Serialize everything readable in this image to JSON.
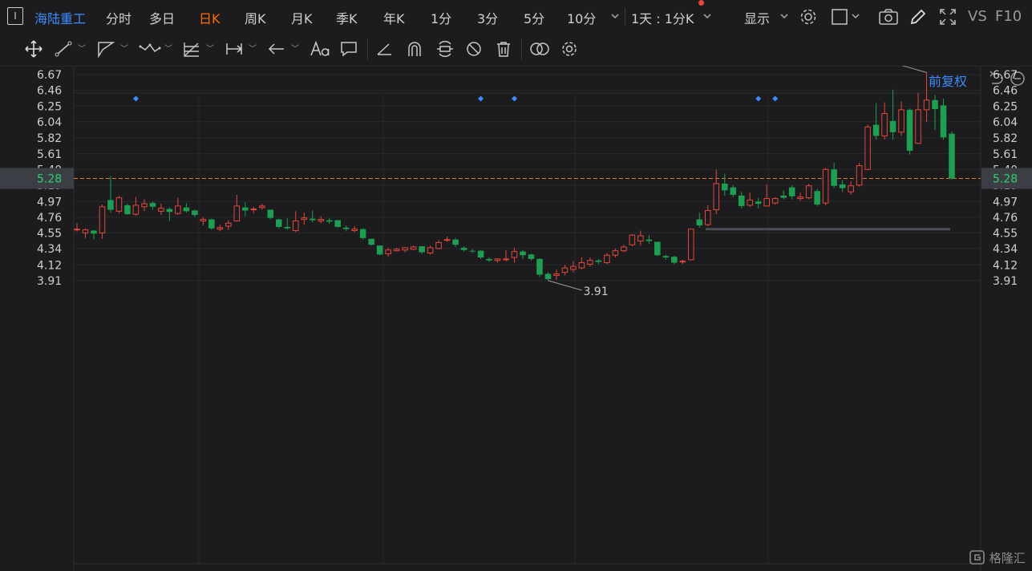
{
  "header": {
    "symbol_box": "I",
    "symbol_name": "海陆重工",
    "periods": [
      "分时",
      "多日",
      "日K",
      "周K",
      "月K",
      "季K",
      "年K",
      "1分",
      "3分",
      "5分",
      "10分"
    ],
    "active_period": "日K",
    "more_periods_icon": "chevron-down-icon",
    "interval_label": "1天 : 1分K",
    "display_label": "显示",
    "vs_label": "VS",
    "f10_label": "F10"
  },
  "tools": [
    "move-icon",
    "line-tool-icon",
    "polygon-tool-icon",
    "wave-tool-icon",
    "fib-tool-icon",
    "range-tool-icon",
    "arrow-tool-icon",
    "text-tool-icon",
    "comment-tool-icon",
    "angle-tool-icon",
    "magnet-icon",
    "sync-icon",
    "hide-drawings-icon",
    "trash-icon",
    "overlay-icon",
    "settings-icon"
  ],
  "adjust_label": "前复权",
  "watermark": "格隆汇",
  "colors": {
    "up": "#e5473b",
    "down": "#1e9e52",
    "accent": "#3d8bff",
    "active": "#ff6a00",
    "ref_line": "#e07a27"
  },
  "chart_data": {
    "type": "candlestick",
    "y_ticks": [
      6.67,
      6.46,
      6.25,
      6.04,
      5.82,
      5.61,
      5.4,
      5.19,
      4.97,
      4.76,
      4.55,
      4.34,
      4.12,
      3.91
    ],
    "ylim": [
      3.8,
      6.85
    ],
    "current_price": 5.28,
    "max_label": "6.70",
    "min_label": "3.91",
    "support_level": 4.6,
    "event_markers": [
      7,
      48,
      52,
      81,
      83,
      124,
      155,
      157,
      161,
      163,
      171,
      173,
      177,
      181
    ],
    "ohlc": [
      [
        4.59,
        4.6,
        4.57,
        4.68
      ],
      [
        4.55,
        4.59,
        4.48,
        4.61
      ],
      [
        4.58,
        4.54,
        4.46,
        4.59
      ],
      [
        4.55,
        4.9,
        4.47,
        4.93
      ],
      [
        4.99,
        4.86,
        4.82,
        5.31
      ],
      [
        4.84,
        5.02,
        4.81,
        5.05
      ],
      [
        4.92,
        4.8,
        4.79,
        4.94
      ],
      [
        4.8,
        4.92,
        4.78,
        5.03
      ],
      [
        4.9,
        4.94,
        4.84,
        5.0
      ],
      [
        4.95,
        4.9,
        4.86,
        4.97
      ],
      [
        4.84,
        4.88,
        4.79,
        4.94
      ],
      [
        4.87,
        4.83,
        4.71,
        4.89
      ],
      [
        4.81,
        4.91,
        4.79,
        5.02
      ],
      [
        4.89,
        4.84,
        4.82,
        4.95
      ],
      [
        4.85,
        4.79,
        4.76,
        4.86
      ],
      [
        4.71,
        4.73,
        4.65,
        4.76
      ],
      [
        4.73,
        4.61,
        4.59,
        4.74
      ],
      [
        4.6,
        4.62,
        4.57,
        4.66
      ],
      [
        4.64,
        4.68,
        4.59,
        4.72
      ],
      [
        4.71,
        4.91,
        4.7,
        5.06
      ],
      [
        4.89,
        4.85,
        4.77,
        4.96
      ],
      [
        4.86,
        4.87,
        4.81,
        4.9
      ],
      [
        4.89,
        4.91,
        4.86,
        4.94
      ],
      [
        4.86,
        4.75,
        4.73,
        4.86
      ],
      [
        4.73,
        4.63,
        4.61,
        4.74
      ],
      [
        4.63,
        4.61,
        4.59,
        4.75
      ],
      [
        4.58,
        4.71,
        4.56,
        4.84
      ],
      [
        4.73,
        4.75,
        4.66,
        4.82
      ],
      [
        4.74,
        4.72,
        4.69,
        4.85
      ],
      [
        4.71,
        4.73,
        4.68,
        4.77
      ],
      [
        4.72,
        4.7,
        4.67,
        4.75
      ],
      [
        4.72,
        4.63,
        4.62,
        4.72
      ],
      [
        4.62,
        4.6,
        4.57,
        4.65
      ],
      [
        4.58,
        4.6,
        4.56,
        4.64
      ],
      [
        4.6,
        4.48,
        4.46,
        4.61
      ],
      [
        4.47,
        4.39,
        4.38,
        4.47
      ],
      [
        4.38,
        4.26,
        4.25,
        4.38
      ],
      [
        4.27,
        4.32,
        4.23,
        4.35
      ],
      [
        4.31,
        4.33,
        4.3,
        4.35
      ],
      [
        4.32,
        4.35,
        4.29,
        4.36
      ],
      [
        4.33,
        4.36,
        4.32,
        4.38
      ],
      [
        4.37,
        4.29,
        4.27,
        4.37
      ],
      [
        4.28,
        4.35,
        4.26,
        4.38
      ],
      [
        4.34,
        4.42,
        4.33,
        4.45
      ],
      [
        4.45,
        4.46,
        4.43,
        4.5
      ],
      [
        4.46,
        4.39,
        4.36,
        4.48
      ],
      [
        4.35,
        4.32,
        4.3,
        4.37
      ],
      [
        4.31,
        4.3,
        4.28,
        4.33
      ],
      [
        4.31,
        4.22,
        4.2,
        4.32
      ],
      [
        4.2,
        4.18,
        4.16,
        4.22
      ],
      [
        4.18,
        4.2,
        4.15,
        4.21
      ],
      [
        4.19,
        4.2,
        4.17,
        4.32
      ],
      [
        4.22,
        4.3,
        4.15,
        4.35
      ],
      [
        4.3,
        4.25,
        4.2,
        4.32
      ],
      [
        4.26,
        4.2,
        4.18,
        4.27
      ],
      [
        4.2,
        3.99,
        3.96,
        4.21
      ],
      [
        4.0,
        3.93,
        3.91,
        4.02
      ],
      [
        3.98,
        4.0,
        3.92,
        4.06
      ],
      [
        4.02,
        4.08,
        3.98,
        4.12
      ],
      [
        4.06,
        4.1,
        4.02,
        4.17
      ],
      [
        4.08,
        4.15,
        4.06,
        4.22
      ],
      [
        4.13,
        4.18,
        4.1,
        4.22
      ],
      [
        4.18,
        4.16,
        4.13,
        4.2
      ],
      [
        4.15,
        4.25,
        4.13,
        4.28
      ],
      [
        4.25,
        4.31,
        4.22,
        4.34
      ],
      [
        4.31,
        4.36,
        4.29,
        4.39
      ],
      [
        4.39,
        4.52,
        4.37,
        4.53
      ],
      [
        4.44,
        4.51,
        4.38,
        4.58
      ],
      [
        4.46,
        4.44,
        4.4,
        4.52
      ],
      [
        4.43,
        4.25,
        4.24,
        4.43
      ],
      [
        4.24,
        4.22,
        4.19,
        4.26
      ],
      [
        4.23,
        4.15,
        4.13,
        4.24
      ],
      [
        4.16,
        4.17,
        4.13,
        4.19
      ],
      [
        4.19,
        4.6,
        4.18,
        4.6
      ],
      [
        4.73,
        4.65,
        4.62,
        4.82
      ],
      [
        4.66,
        4.85,
        4.64,
        4.92
      ],
      [
        4.86,
        5.21,
        4.8,
        5.4
      ],
      [
        5.21,
        5.12,
        5.05,
        5.34
      ],
      [
        5.16,
        5.06,
        5.03,
        5.19
      ],
      [
        5.05,
        4.91,
        4.88,
        5.1
      ],
      [
        4.92,
        4.99,
        4.9,
        5.09
      ],
      [
        4.97,
        4.94,
        4.88,
        5.02
      ],
      [
        4.91,
        5.01,
        4.9,
        5.2
      ],
      [
        4.95,
        5.01,
        4.93,
        5.03
      ],
      [
        5.05,
        5.02,
        5.0,
        5.12
      ],
      [
        5.16,
        5.04,
        5.0,
        5.19
      ],
      [
        5.01,
        5.03,
        4.98,
        5.09
      ],
      [
        5.02,
        5.18,
        5.0,
        5.21
      ],
      [
        5.11,
        4.93,
        4.91,
        5.14
      ],
      [
        4.95,
        5.4,
        4.92,
        5.42
      ],
      [
        5.4,
        5.18,
        5.15,
        5.49
      ],
      [
        5.2,
        5.15,
        5.1,
        5.26
      ],
      [
        5.1,
        5.18,
        5.06,
        5.24
      ],
      [
        5.19,
        5.45,
        5.17,
        5.49
      ],
      [
        5.4,
        5.97,
        5.39,
        6.0
      ],
      [
        6.0,
        5.85,
        5.8,
        6.29
      ],
      [
        5.85,
        6.15,
        5.8,
        6.3
      ],
      [
        6.05,
        5.9,
        5.8,
        6.47
      ],
      [
        5.9,
        6.2,
        5.85,
        6.31
      ],
      [
        6.2,
        5.65,
        5.6,
        6.22
      ],
      [
        5.75,
        6.2,
        5.74,
        6.43
      ],
      [
        6.2,
        6.33,
        6.04,
        6.7
      ],
      [
        6.33,
        6.21,
        5.93,
        6.4
      ],
      [
        6.26,
        5.83,
        5.8,
        6.35
      ],
      [
        5.88,
        5.28,
        5.26,
        5.91
      ]
    ]
  }
}
